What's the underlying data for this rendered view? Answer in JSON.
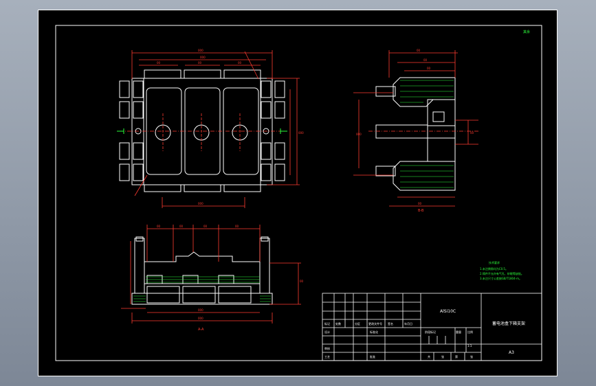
{
  "title_block": {
    "material": "AlSi10C",
    "drawing_name": "蓄电池盒下箱支架",
    "sheet_size": "A3",
    "scale": "1:1",
    "marks_row": [
      "标记",
      "处数",
      "分区",
      "更改文件号",
      "签名",
      "年月日"
    ],
    "design_label": "设计",
    "standard_label": "标准化",
    "review_label": "审核",
    "process_label": "工艺",
    "approve_label": "批准",
    "stage_label": "阶段标记",
    "weight_label": "重量",
    "scale_label": "比例",
    "sheet_total": "共",
    "sheet_label": "张",
    "sheet_no": "第",
    "sheet_no_label": "张"
  },
  "views": {
    "section_label_bottom": "A-A",
    "section_label_right": "B-B",
    "corner_note": "其余"
  },
  "notes": {
    "heading": "技术要求",
    "lines": [
      "1.未注倒角均为C0.5。",
      "2.铸件不允许有气孔、砂眼等缺陷。",
      "3.未注尺寸公差按GB/T1804-m。"
    ]
  },
  "colors": {
    "sheet": "#000000",
    "outline": "#ffffff",
    "dimension": "#ff3b30",
    "center": "#ff3b30",
    "hatch": "#2cff3c",
    "note": "#2cff3c"
  }
}
